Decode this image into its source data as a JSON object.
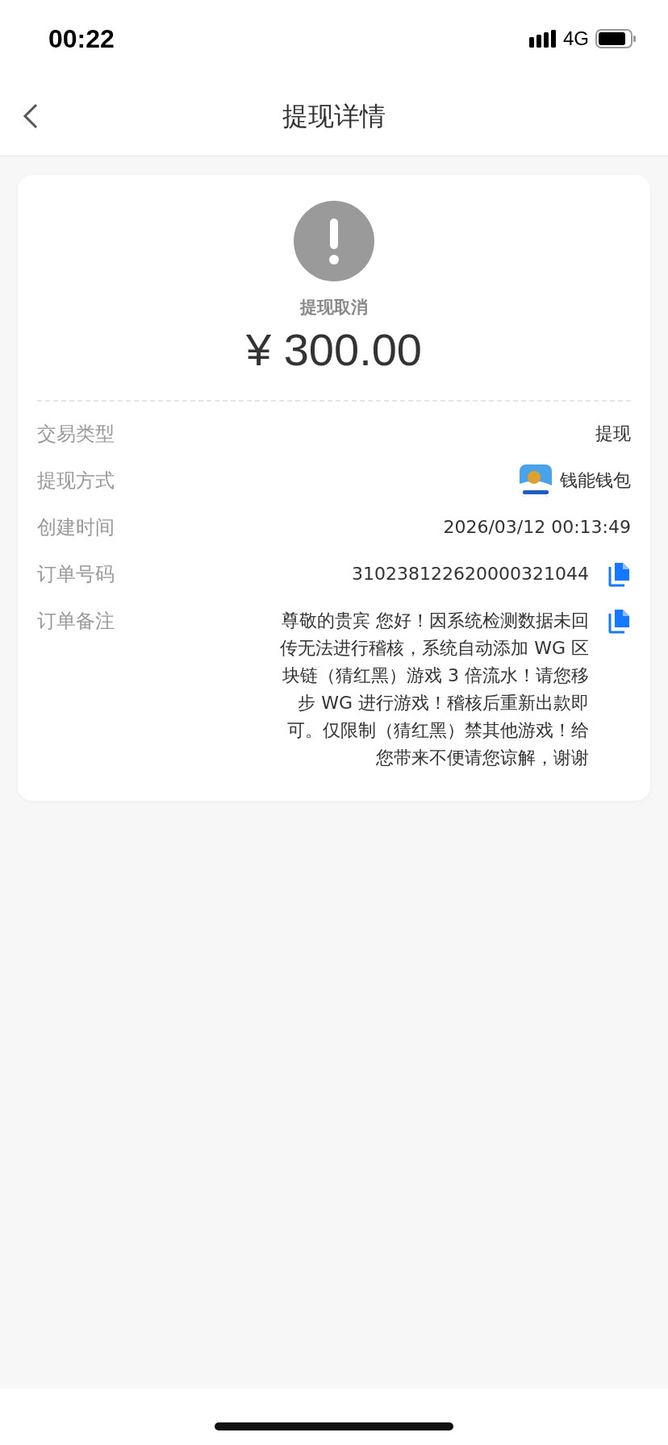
{
  "status_bar": {
    "time": "00:22",
    "network": "4G"
  },
  "nav": {
    "title": "提现详情"
  },
  "summary": {
    "status": "提现取消",
    "amount": "¥ 300.00"
  },
  "rows": [
    {
      "kind": "plain",
      "label": "交易类型",
      "value": "提现"
    },
    {
      "kind": "app",
      "label": "提现方式",
      "value": "钱能钱包"
    },
    {
      "kind": "plain",
      "label": "创建时间",
      "value": "2026/03/12 00:13:49"
    },
    {
      "kind": "copy",
      "label": "订单号码",
      "value": "310238122620000321044"
    },
    {
      "kind": "copy",
      "label": "订单备注",
      "value": "尊敬的贵宾 您好！因系统检测数据未回传无法进行稽核，系统自动添加 WG 区块链（猜红黑）游戏 3 倍流水！请您移步 WG 进行游戏！稽核后重新出款即可。仅限制（猜红黑）禁其他游戏！给您带来不便请您谅解，谢谢"
    }
  ]
}
